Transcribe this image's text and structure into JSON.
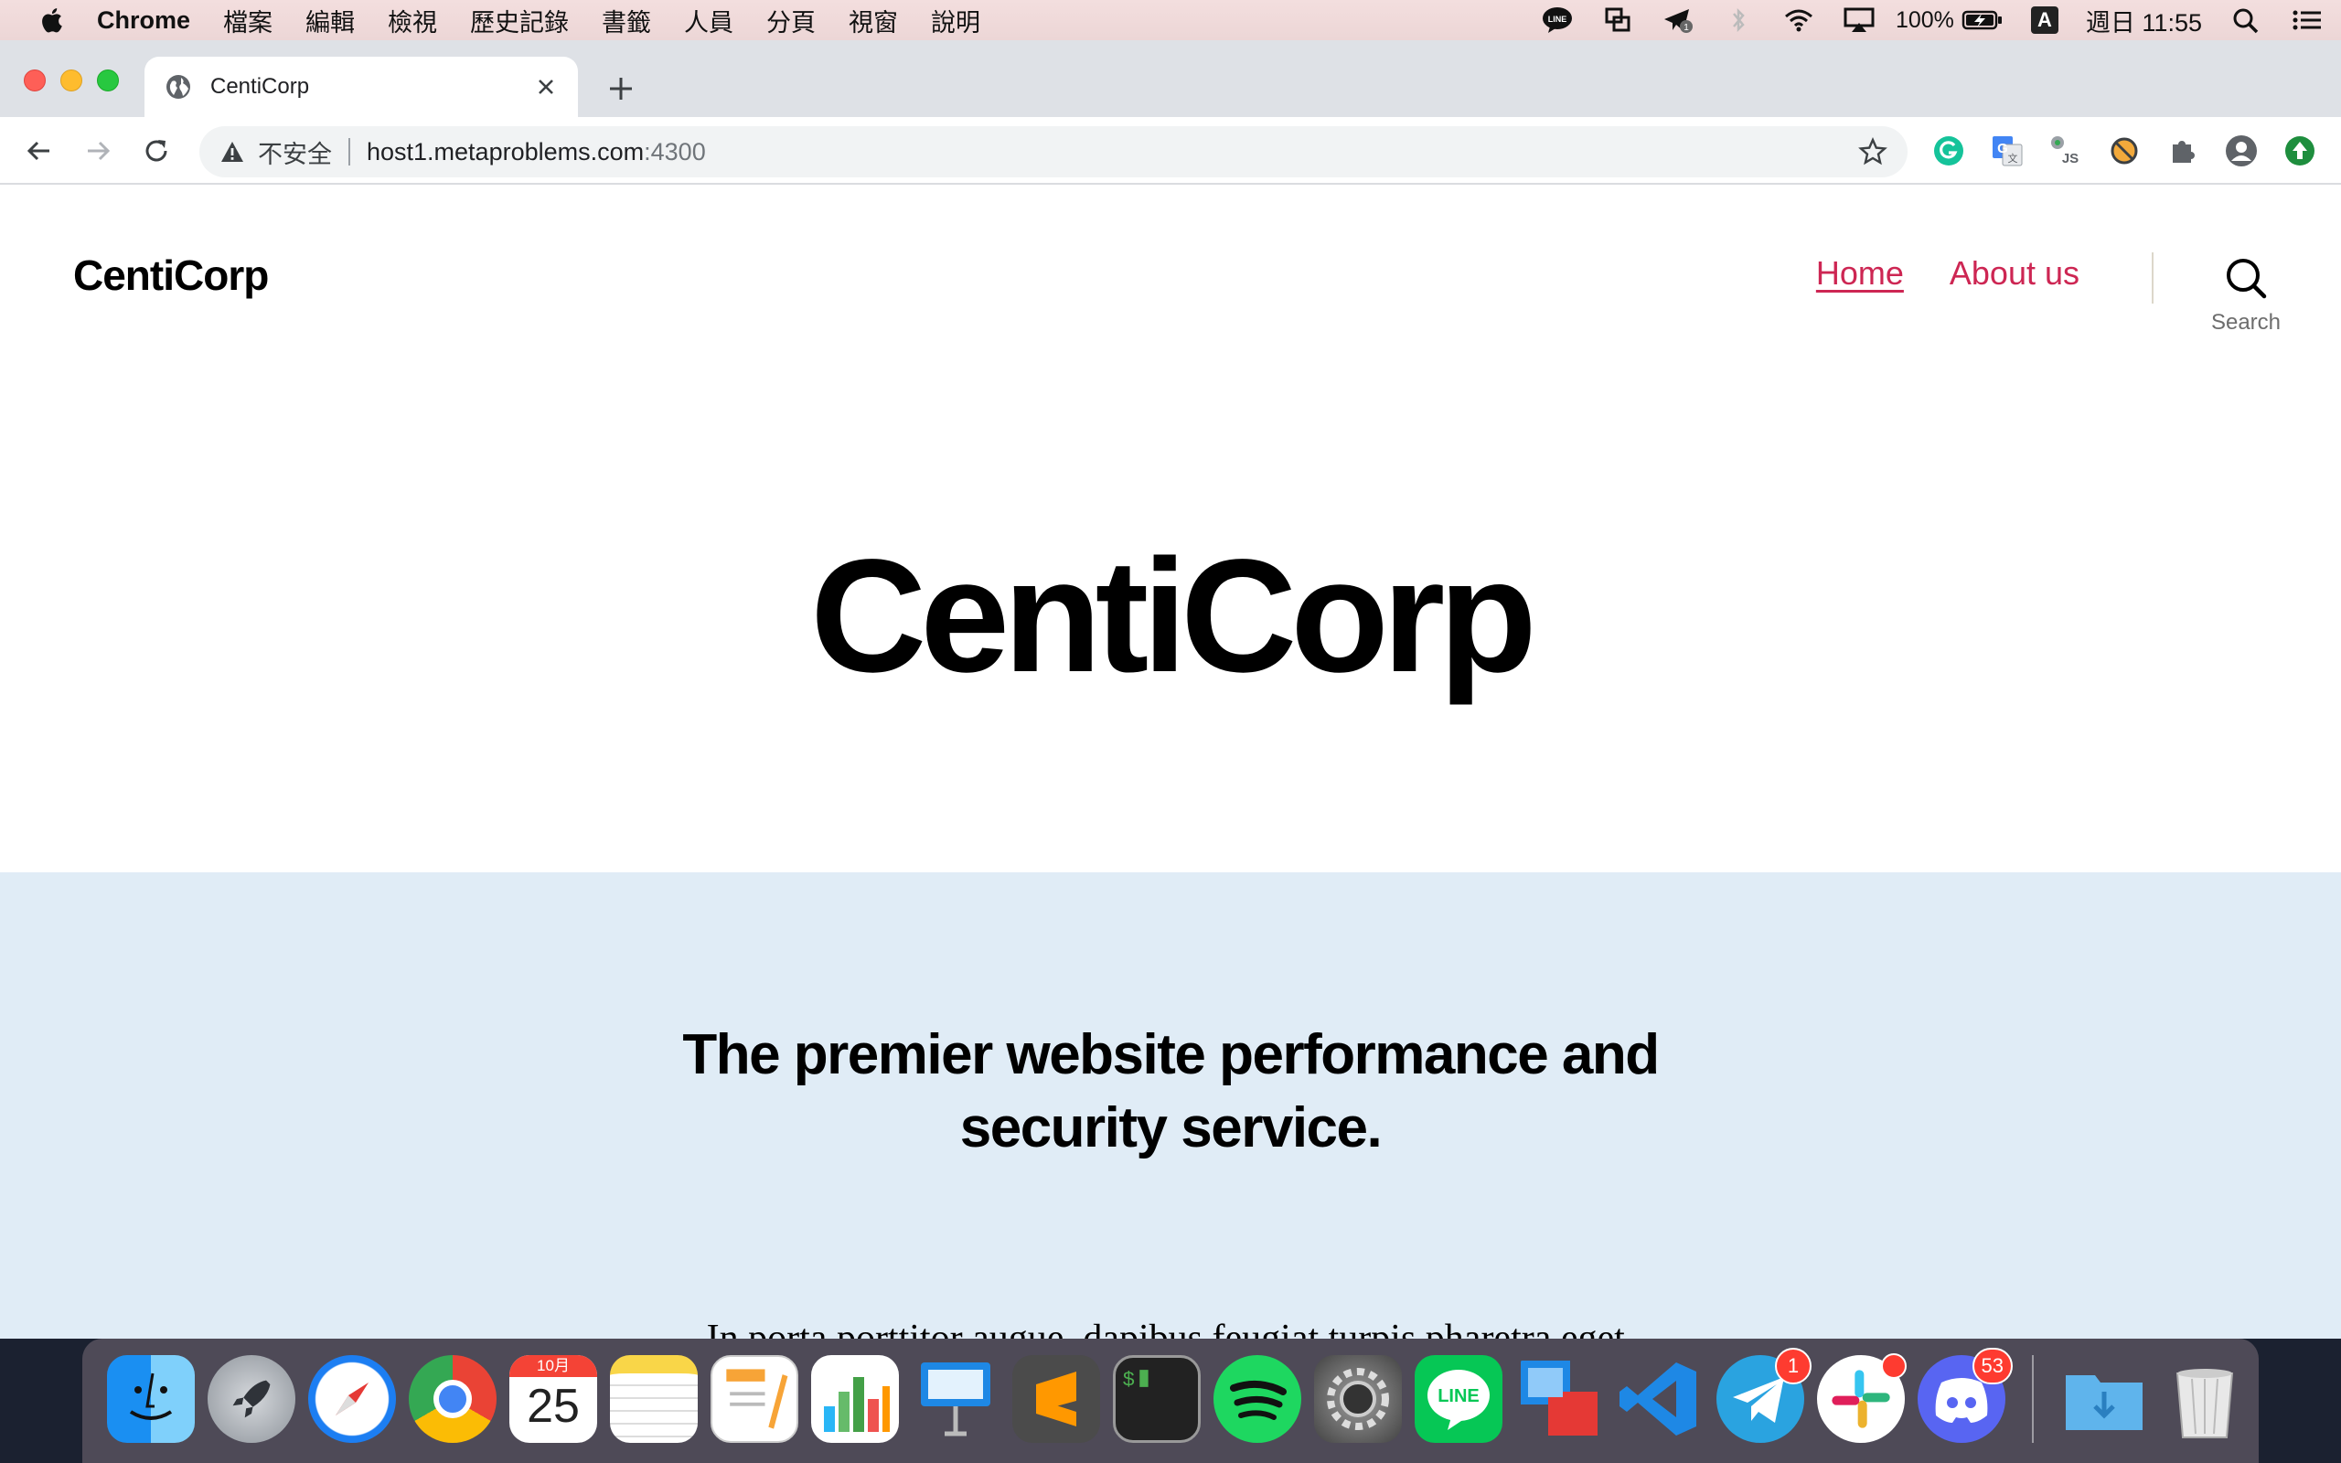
{
  "menubar": {
    "app_name": "Chrome",
    "items": [
      "檔案",
      "編輯",
      "檢視",
      "歷史記錄",
      "書籤",
      "人員",
      "分頁",
      "視窗",
      "說明"
    ],
    "battery": "100%",
    "ime": "A",
    "clock": "週日 11:55"
  },
  "browser": {
    "tab_title": "CentiCorp",
    "security_label": "不安全",
    "url_host": "host1.metaproblems.com",
    "url_port": ":4300"
  },
  "site": {
    "logo": "CentiCorp",
    "nav": [
      {
        "label": "Home",
        "current": true
      },
      {
        "label": "About us",
        "current": false
      }
    ],
    "search_label": "Search",
    "hero_title": "CentiCorp",
    "cover_title": "The premier website performance and security service.",
    "cover_text": "In porta porttitor augue, dapibus feugiat turpis pharetra eget."
  },
  "dock": {
    "calendar_month": "10月",
    "calendar_day": "25",
    "telegram_badge": "1",
    "discord_badge": "53",
    "line_label": "LINE"
  },
  "colors": {
    "accent": "#cd2653",
    "cover_bg": "#e0ecf6",
    "tabstrip": "#dee1e6",
    "menubar": "#efd9d9"
  }
}
